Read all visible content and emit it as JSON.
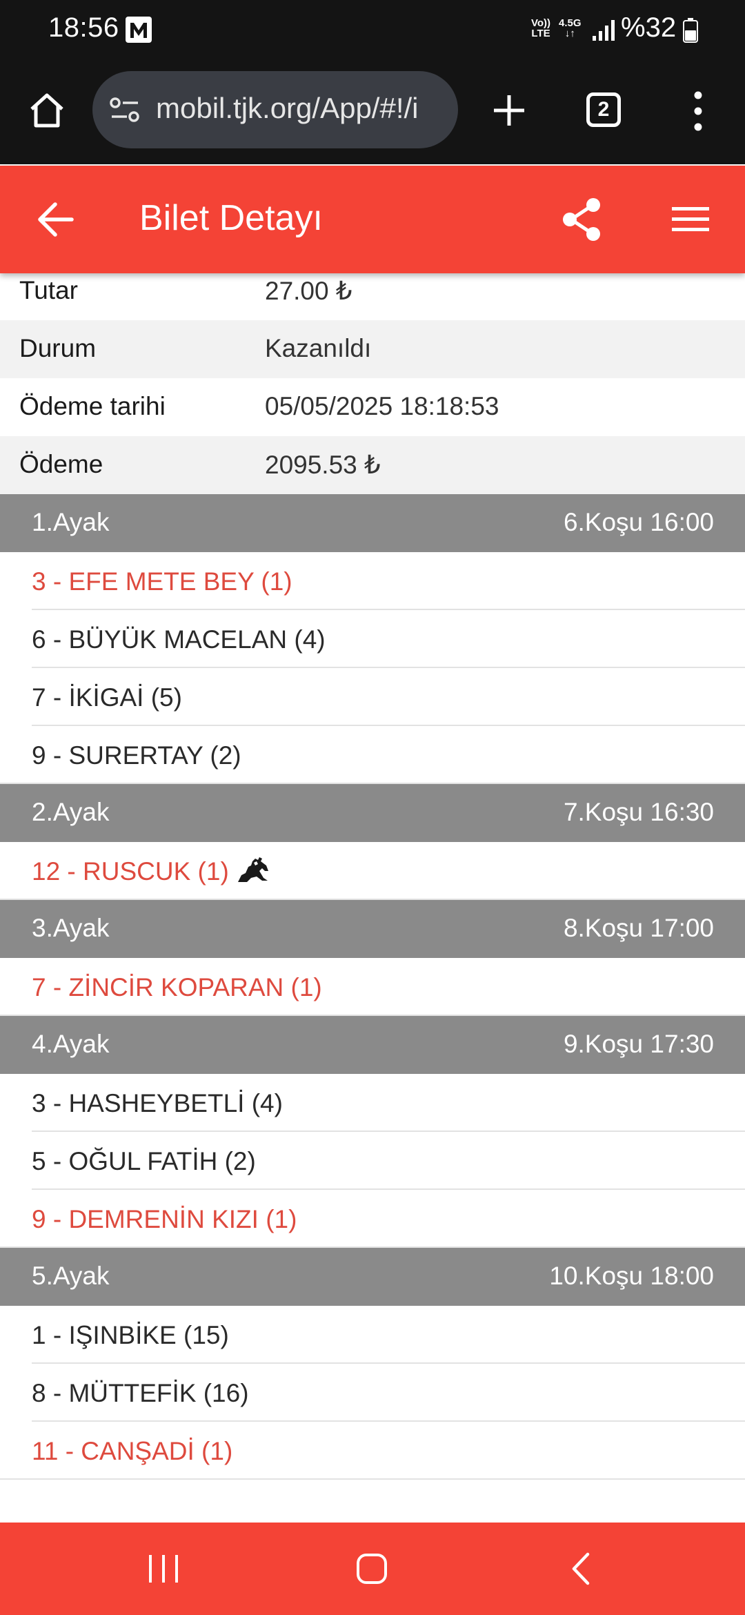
{
  "status_bar": {
    "time": "18:56",
    "volte_top": "Vo))",
    "volte_bottom": "LTE",
    "network_top": "4.5G",
    "network_bottom": "↓↑",
    "battery_text": "%32",
    "icons": [
      "gmail-m-icon",
      "volte-icon",
      "network-type-icon",
      "signal-icon",
      "battery-icon"
    ]
  },
  "browser": {
    "url": "mobil.tjk.org/App/#!/i",
    "tab_count": "2",
    "icons": [
      "home-icon",
      "site-settings-icon",
      "plus-icon",
      "tabs-icon",
      "more-vert-icon"
    ]
  },
  "header": {
    "title": "Bilet Detayı",
    "bg_color": "#f44336",
    "icons": [
      "arrow-back-icon",
      "share-icon",
      "menu-icon"
    ]
  },
  "ticket": {
    "rows": [
      {
        "label": "Tutar",
        "value": "27.00 ₺"
      },
      {
        "label": "Durum",
        "value": "Kazanıldı"
      },
      {
        "label": "Ödeme tarihi",
        "value": "05/05/2025 18:18:53"
      },
      {
        "label": "Ödeme",
        "value": "2095.53 ₺"
      }
    ]
  },
  "legs": [
    {
      "name": "1.Ayak",
      "race": "6.Koşu 16:00",
      "horses": [
        {
          "text": "3 - EFE METE BEY (1)",
          "winner": true
        },
        {
          "text": "6 - BÜYÜK MACELAN (4)",
          "winner": false
        },
        {
          "text": "7 - İKİGAİ (5)",
          "winner": false
        },
        {
          "text": "9 - SURERTAY (2)",
          "winner": false
        }
      ]
    },
    {
      "name": "2.Ayak",
      "race": "7.Koşu 16:30",
      "horses": [
        {
          "text": "12 - RUSCUK (1)",
          "winner": true,
          "icon": "horse-jockey-icon"
        }
      ]
    },
    {
      "name": "3.Ayak",
      "race": "8.Koşu 17:00",
      "horses": [
        {
          "text": "7 - ZİNCİR KOPARAN (1)",
          "winner": true
        }
      ]
    },
    {
      "name": "4.Ayak",
      "race": "9.Koşu 17:30",
      "horses": [
        {
          "text": "3 - HASHEYBETLİ (4)",
          "winner": false
        },
        {
          "text": "5 - OĞUL FATİH (2)",
          "winner": false
        },
        {
          "text": "9 - DEMRENİN KIZI (1)",
          "winner": true
        }
      ]
    },
    {
      "name": "5.Ayak",
      "race": "10.Koşu 18:00",
      "horses": [
        {
          "text": "1 - IŞINBİKE (15)",
          "winner": false
        },
        {
          "text": "8 - MÜTTEFİK (16)",
          "winner": false
        },
        {
          "text": "11 - CANŞADİ (1)",
          "winner": true
        }
      ]
    }
  ],
  "colors": {
    "accent": "#f44336",
    "winner_text": "#de4a3e",
    "leg_header_bg": "#8a8a8a"
  },
  "nav_bar": {
    "icons": [
      "recents-icon",
      "home-circle-icon",
      "back-chevron-icon"
    ]
  }
}
